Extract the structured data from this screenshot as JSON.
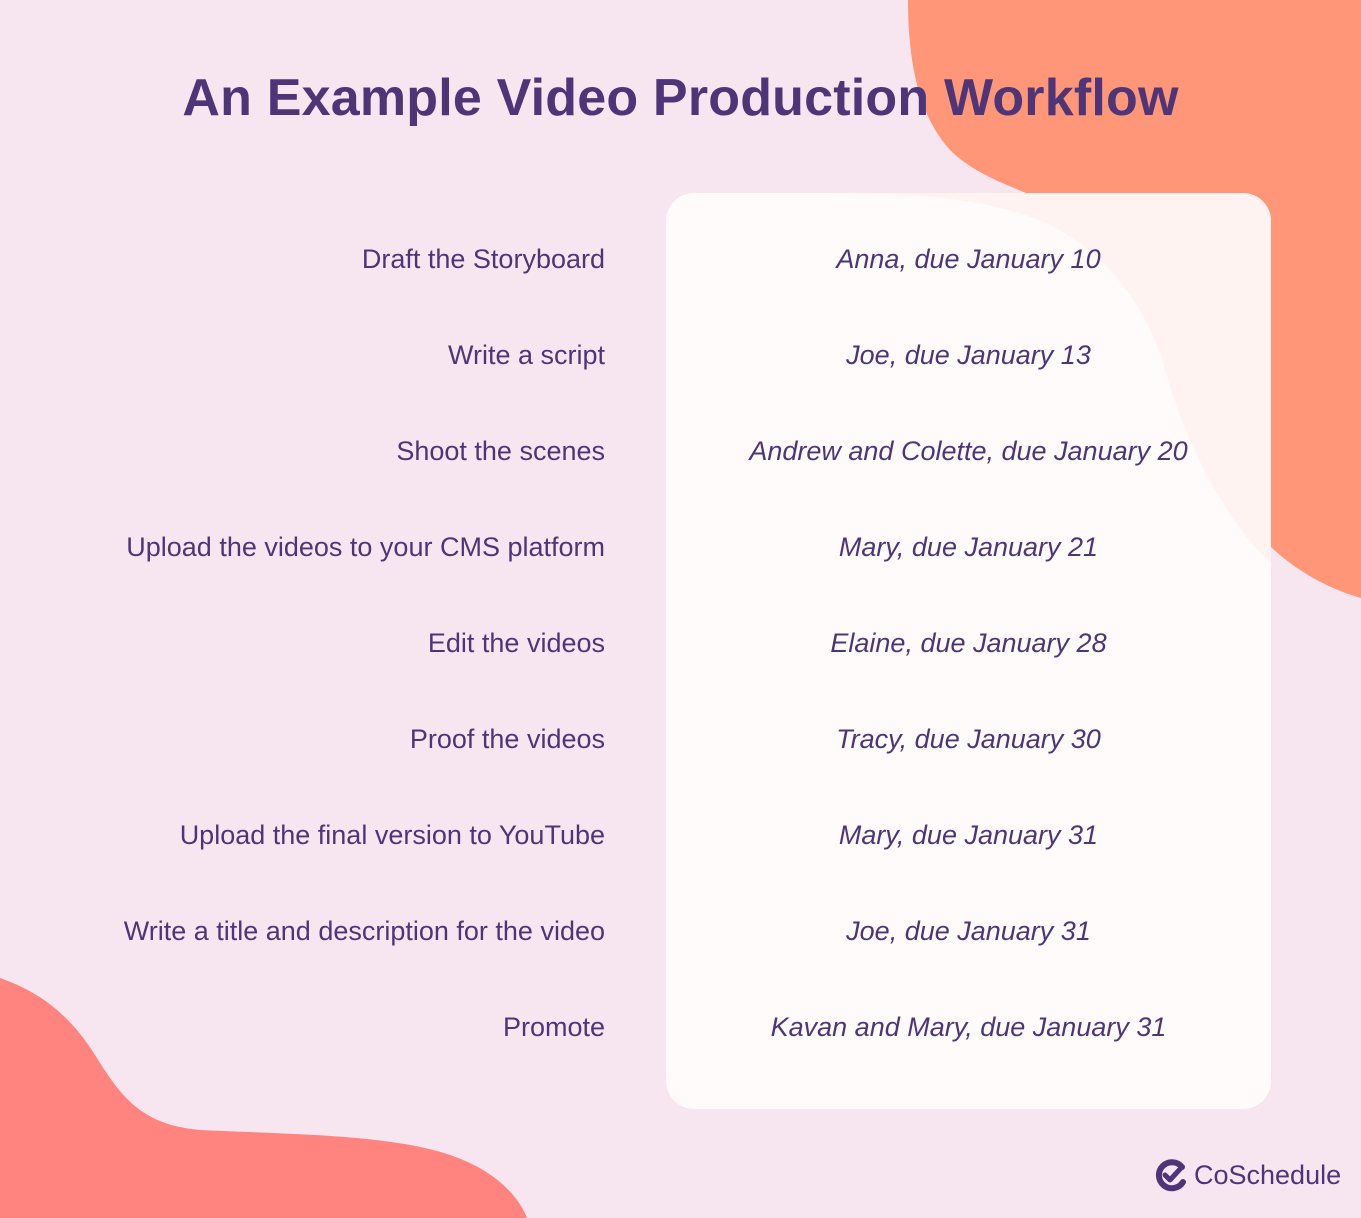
{
  "header": {
    "title": "An Example Video Production Workflow"
  },
  "colors": {
    "background": "#f7e6f0",
    "text": "#4e3577",
    "blob_top_right": "#ff9677",
    "blob_bottom_left": "#ff837f",
    "card": "#fffbfb",
    "card_tint": "#fff3f1"
  },
  "workflow": {
    "rows": [
      {
        "task": "Draft the Storyboard",
        "owner": "Anna, due January 10"
      },
      {
        "task": "Write a script",
        "owner": "Joe, due January 13"
      },
      {
        "task": "Shoot the scenes",
        "owner": "Andrew and Colette, due January 20"
      },
      {
        "task": "Upload the videos to your CMS platform",
        "owner": "Mary, due January 21"
      },
      {
        "task": "Edit the videos",
        "owner": "Elaine, due January 28"
      },
      {
        "task": "Proof the videos",
        "owner": "Tracy, due January 30"
      },
      {
        "task": "Upload the final version to YouTube",
        "owner": "Mary, due January 31"
      },
      {
        "task": "Write a title and description for the video",
        "owner": "Joe, due January 31"
      },
      {
        "task": "Promote",
        "owner": "Kavan and Mary, due January 31"
      }
    ]
  },
  "footer": {
    "brand": "CoSchedule",
    "brand_icon": "check-circle-logo-icon"
  }
}
